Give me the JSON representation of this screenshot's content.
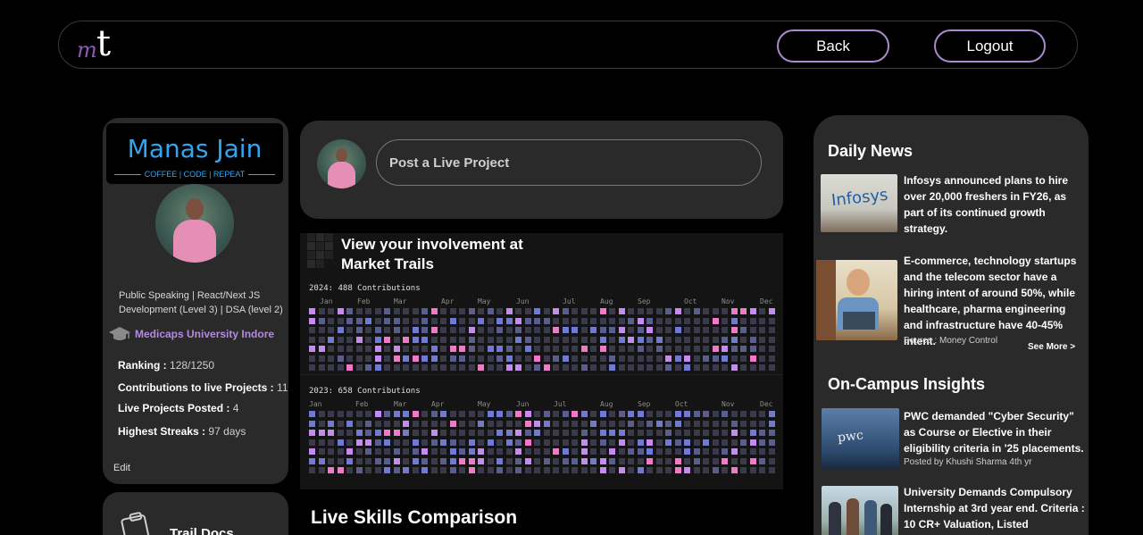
{
  "header": {
    "logo_script": "m",
    "logo_letter": "t",
    "back_label": "Back",
    "logout_label": "Logout"
  },
  "profile": {
    "name": "Manas Jain",
    "tagline": "COFFEE | CODE | REPEAT",
    "bio": "Public Speaking | React/Next JS Development (Level 3) | DSA (level 2)",
    "university": "Medicaps University Indore",
    "stats": [
      {
        "label": "Ranking :",
        "value": "128/1250"
      },
      {
        "label": "Contributions to live Projects :",
        "value": "11"
      },
      {
        "label": "Live Projects Posted :",
        "value": "4"
      },
      {
        "label": "Highest Streaks :",
        "value": "97 days"
      }
    ],
    "edit_label": "Edit"
  },
  "trail_card": {
    "title": "Trail Docs"
  },
  "post": {
    "placeholder": "Post a Live Project"
  },
  "contributions": {
    "title_line1": "View your involvement at",
    "title_line2": "Market Trails",
    "years": [
      {
        "label": "2024: 488 Contributions",
        "months": [
          "Jan",
          "Feb",
          "Mar",
          "Apr",
          "May",
          "Jun",
          "Jul",
          "Aug",
          "Sep",
          "Oct",
          "Nov",
          "Dec"
        ]
      },
      {
        "label": "2023: 658 Contributions",
        "months": [
          "Jan",
          "Feb",
          "Mar",
          "Apr",
          "May",
          "Jun",
          "Jul",
          "Aug",
          "Sep",
          "Oct",
          "Nov",
          "Dec"
        ]
      }
    ],
    "colors": {
      "empty": "#3a3a4a",
      "low": "#5a5e8c",
      "mid": "#6f7ad0",
      "high": "#c58cf0",
      "top": "#f07ac8"
    }
  },
  "skills": {
    "title": "Live Skills Comparison"
  },
  "news": {
    "daily_title": "Daily News",
    "daily_items": [
      {
        "text": "Infosys announced plans to hire over 20,000 freshers in FY26, as part of its continued growth strategy.",
        "thumb_label": "Infosys"
      },
      {
        "text": "E-commerce, technology startups and the telecom sector have a hiring intent of around 50%, while healthcare, pharma engineering and infrastructure have 40-45% intent.",
        "source": "Source : Money Control"
      }
    ],
    "see_more": "See More >",
    "campus_title": "On-Campus Insights",
    "campus_items": [
      {
        "text": "PWC demanded \"Cyber Security\" as Course or Elective in their eligibility criteria in '25 placements.",
        "source": "Posted by Khushi Sharma 4th yr",
        "thumb_label": "pwc"
      },
      {
        "text": "University Demands Compulsory Internship at 3rd year end. Criteria : 10 CR+ Valuation, Listed"
      }
    ]
  }
}
